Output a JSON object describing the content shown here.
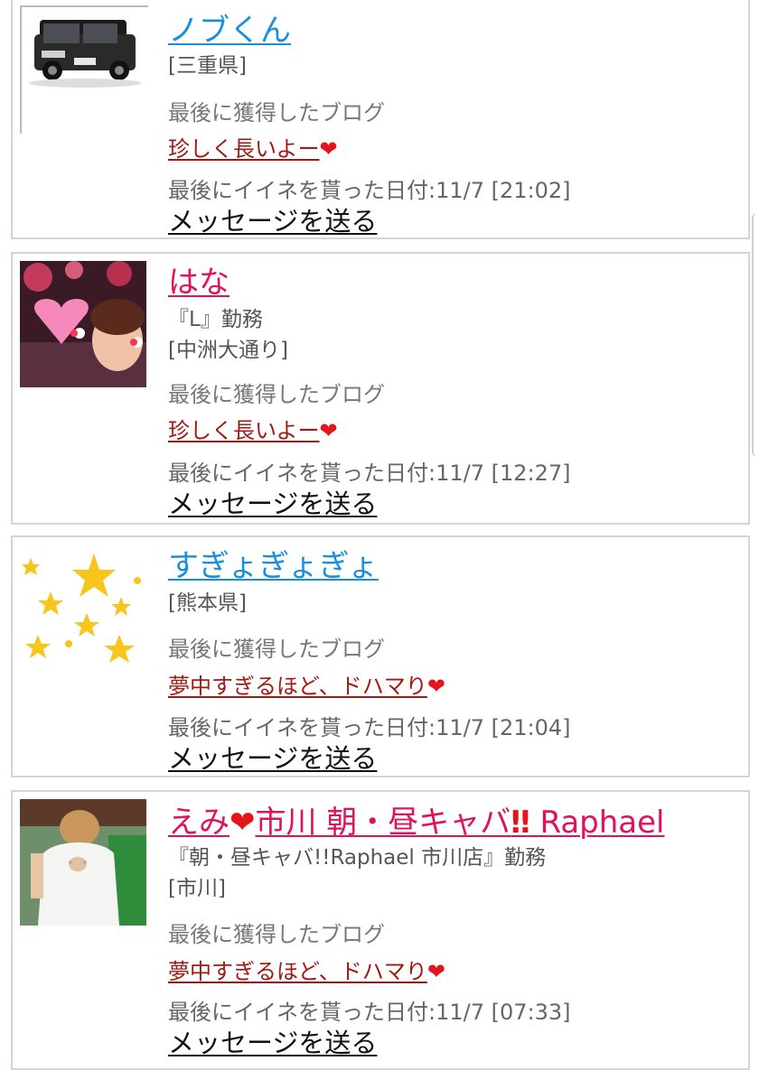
{
  "users": [
    {
      "name": "ノブくん",
      "name_color": "#1a8fdb",
      "meta": [
        "[三重県]"
      ],
      "blog_label": "最後に獲得したブログ",
      "blog_title": "珍しく長いよー",
      "date_text": "最後にイイネを貰った日付:11/7 [21:02]",
      "message_label": "メッセージを送る",
      "avatar": "car-photo"
    },
    {
      "name": "はな",
      "name_color": "#e0115f",
      "meta": [
        "『L』勤務",
        "[中洲大通り]"
      ],
      "blog_label": "最後に獲得したブログ",
      "blog_title": "珍しく長いよー",
      "date_text": "最後にイイネを貰った日付:11/7 [12:27]",
      "message_label": "メッセージを送る",
      "avatar": "woman-photo-heart-sticker"
    },
    {
      "name": "すぎょぎょぎょ",
      "name_color": "#1a8fdb",
      "meta": [
        "[熊本県]"
      ],
      "blog_label": "最後に獲得したブログ",
      "blog_title": "夢中すぎるほど、ドハマり",
      "date_text": "最後にイイネを貰った日付:11/7 [21:04]",
      "message_label": "メッセージを送る",
      "avatar": "yellow-stars"
    },
    {
      "name_part1": "えみ",
      "name_part2": "市川 朝・昼キャバ",
      "name_part3": "‼",
      "name_part4": " Raphael",
      "name_color": "#e0115f",
      "meta": [
        "『朝・昼キャバ!!Raphael 市川店』勤務",
        "[市川]"
      ],
      "blog_label": "最後に獲得したブログ",
      "blog_title": "夢中すぎるほど、ドハマり",
      "date_text": "最後にイイネを貰った日付:11/7 [07:33]",
      "message_label": "メッセージを送る",
      "avatar": "woman-white-dress-photo"
    }
  ],
  "colors": {
    "male_name": "#1a8fdb",
    "female_name": "#e0115f",
    "blog_link": "#a11a14",
    "heart": "#e4141c",
    "card_border": "#d4d4d4"
  },
  "icons": {
    "heart": "heart-icon"
  }
}
